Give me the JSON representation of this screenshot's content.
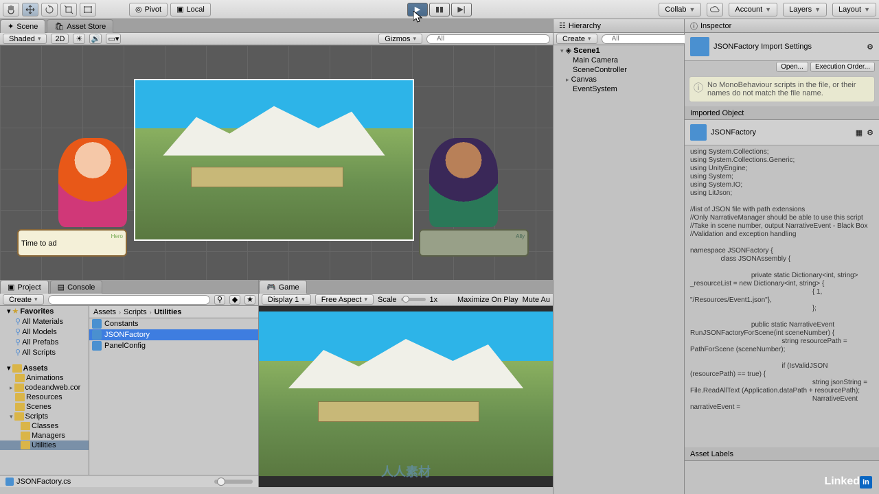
{
  "toolbar": {
    "pivot": "Pivot",
    "local": "Local",
    "collab": "Collab",
    "account": "Account",
    "layers": "Layers",
    "layout": "Layout"
  },
  "tabs": {
    "scene": "Scene",
    "assetStore": "Asset Store",
    "project": "Project",
    "console": "Console",
    "game": "Game",
    "hierarchy": "Hierarchy",
    "inspector": "Inspector"
  },
  "sceneBar": {
    "shaded": "Shaded",
    "mode2d": "2D",
    "gizmos": "Gizmos",
    "searchPH": "All"
  },
  "gameBar": {
    "display": "Display 1",
    "aspect": "Free Aspect",
    "scale": "Scale",
    "scaleVal": "1x",
    "maximize": "Maximize On Play",
    "mute": "Mute Au"
  },
  "hierarchy": {
    "create": "Create",
    "searchPH": "All",
    "items": [
      "Scene1",
      "Main Camera",
      "SceneController",
      "Canvas",
      "EventSystem"
    ]
  },
  "dialogue": {
    "heroName": "Hero",
    "heroLine": "Time to ad",
    "allyName": "Ally"
  },
  "project": {
    "create": "Create",
    "favorites": "Favorites",
    "allMaterials": "All Materials",
    "allModels": "All Models",
    "allPrefabs": "All Prefabs",
    "allScripts": "All Scripts",
    "assets": "Assets",
    "animations": "Animations",
    "codeandweb": "codeandweb.cor",
    "resources": "Resources",
    "scenes": "Scenes",
    "scripts": "Scripts",
    "classes": "Classes",
    "managers": "Managers",
    "utilities": "Utilities",
    "bcAssets": "Assets",
    "bcScripts": "Scripts",
    "bcUtilities": "Utilities",
    "f_constants": "Constants",
    "f_jsonfactory": "JSONFactory",
    "f_panelconfig": "PanelConfig",
    "status": "JSONFactory.cs"
  },
  "inspector": {
    "title": "JSONFactory Import Settings",
    "open": "Open...",
    "execOrder": "Execution Order...",
    "warn": "No MonoBehaviour scripts in the file, or their names do not match the file name.",
    "imported": "Imported Object",
    "objName": "JSONFactory",
    "assetLabels": "Asset Labels",
    "code": "using System.Collections;\nusing System.Collections.Generic;\nusing UnityEngine;\nusing System;\nusing System.IO;\nusing LitJson;\n\n//list of JSON file with path extensions\n//Only NarrativeManager should be able to use this script\n//Take in scene number, output NarrativeEvent - Black Box\n//Validation and exception handling\n\nnamespace JSONFactory {\n                class JSONAssembly {\n\n                                private static Dictionary<int, string> _resourceList = new Dictionary<int, string> {\n                                                                { 1, \"/Resources/Event1.json\"},\n                                                                };\n\n                                public static NarrativeEvent RunJSONFactoryForScene(int sceneNumber) {\n                                                string resourcePath = PathForScene (sceneNumber);\n\n                                                if (IsValidJSON (resourcePath) == true) {\n                                                                string jsonString = File.ReadAllText (Application.dataPath + resourcePath);\n                                                                NarrativeEvent narrativeEvent ="
  },
  "footer": {
    "brand": "Linked",
    "wm": "人人素材"
  }
}
